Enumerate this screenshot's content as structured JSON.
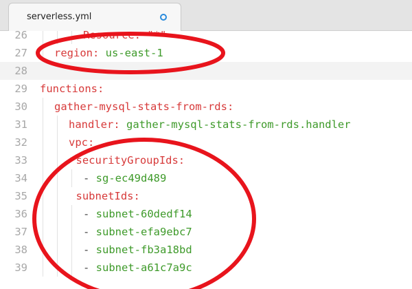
{
  "tab": {
    "title": "serverless.yml"
  },
  "lines": [
    {
      "num": "26",
      "indent": 3,
      "tokens": [
        {
          "t": "Resource: \"*\"",
          "c": "k"
        }
      ]
    },
    {
      "num": "27",
      "indent": 1,
      "tokens": [
        {
          "t": "region:",
          "c": "k"
        },
        {
          "t": " us-east-1",
          "c": "v"
        }
      ]
    },
    {
      "num": "28",
      "indent": 0,
      "tokens": []
    },
    {
      "num": "29",
      "indent": 0,
      "tokens": [
        {
          "t": "functions:",
          "c": "k"
        }
      ]
    },
    {
      "num": "30",
      "indent": 1,
      "tokens": [
        {
          "t": "gather-mysql-stats-from-rds:",
          "c": "k"
        }
      ]
    },
    {
      "num": "31",
      "indent": 2,
      "tokens": [
        {
          "t": "handler:",
          "c": "k"
        },
        {
          "t": " gather-mysql-stats-from-rds.handler",
          "c": "v"
        }
      ]
    },
    {
      "num": "32",
      "indent": 2,
      "tokens": [
        {
          "t": "vpc:",
          "c": "k"
        }
      ]
    },
    {
      "num": "33",
      "indent": 2.5,
      "tokens": [
        {
          "t": "securityGroupIds:",
          "c": "k"
        }
      ]
    },
    {
      "num": "34",
      "indent": 3,
      "tokens": [
        {
          "t": "- ",
          "c": "p"
        },
        {
          "t": "sg-ec49d489",
          "c": "v"
        }
      ]
    },
    {
      "num": "35",
      "indent": 2.5,
      "tokens": [
        {
          "t": "subnetIds:",
          "c": "k"
        }
      ]
    },
    {
      "num": "36",
      "indent": 3,
      "tokens": [
        {
          "t": "- ",
          "c": "p"
        },
        {
          "t": "subnet-60dedf14",
          "c": "v"
        }
      ]
    },
    {
      "num": "37",
      "indent": 3,
      "tokens": [
        {
          "t": "- ",
          "c": "p"
        },
        {
          "t": "subnet-efa9ebc7",
          "c": "v"
        }
      ]
    },
    {
      "num": "38",
      "indent": 3,
      "tokens": [
        {
          "t": "- ",
          "c": "p"
        },
        {
          "t": "subnet-fb3a18bd",
          "c": "v"
        }
      ]
    },
    {
      "num": "39",
      "indent": 3,
      "tokens": [
        {
          "t": "- ",
          "c": "p"
        },
        {
          "t": "subnet-a61c7a9c",
          "c": "v"
        }
      ]
    }
  ],
  "colors": {
    "key": "#d73a3a",
    "value": "#3e9a2a",
    "annotation": "#e8141c"
  }
}
